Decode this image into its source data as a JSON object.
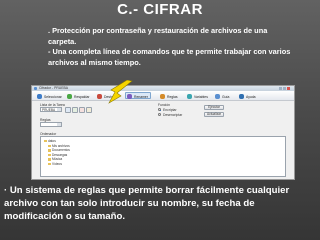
{
  "slide": {
    "title": "C.- CIFRAR",
    "bullet_1": ". Protección por contraseña y restauración de archivos de una carpeta.",
    "bullet_2": "- Una completa línea de comandos que te permite trabajar con varios  archivos al mismo tiempo.",
    "bottom_text": "·  Un sistema de reglas que permite borrar fácilmente cualquier archivo con tan solo introducir su nombre, su fecha de modificación o su tamaño."
  },
  "app": {
    "window_title": "Cifrador - PRUEBA",
    "toolbar": [
      {
        "label": "Seleccionar",
        "color": "#3d7cc9"
      },
      {
        "label": "Respaldar",
        "color": "#4aa845"
      },
      {
        "label": "Deshacer",
        "color": "#c94a3d"
      },
      {
        "label": "Renamer",
        "color": "#7a5bc0",
        "active": true
      },
      {
        "label": "Reglas",
        "color": "#d48b2a"
      },
      {
        "label": "Variables",
        "color": "#3aa6b0"
      },
      {
        "label": "Guía",
        "color": "#5a8fd0"
      },
      {
        "label": "Ayuda",
        "color": "#2f6fb0"
      }
    ],
    "left_label": "Lista de la Tarea",
    "left_combo": "PRUEBA",
    "rules_label": "Reglas",
    "right_label": "Función",
    "radio_1": "Encriptar",
    "radio_2": "Desencriptar",
    "btn_ejecutar": "Ejecutar",
    "btn_actualizar": "Actualizar",
    "ordenador_label": "Ordenador",
    "tree_items": [
      "datos",
      "Mis archivos",
      "Documentos",
      "Descargas",
      "Música",
      "Vídeos"
    ]
  },
  "colors": {
    "arrow": "#f5d400",
    "title": "#ffffff"
  }
}
